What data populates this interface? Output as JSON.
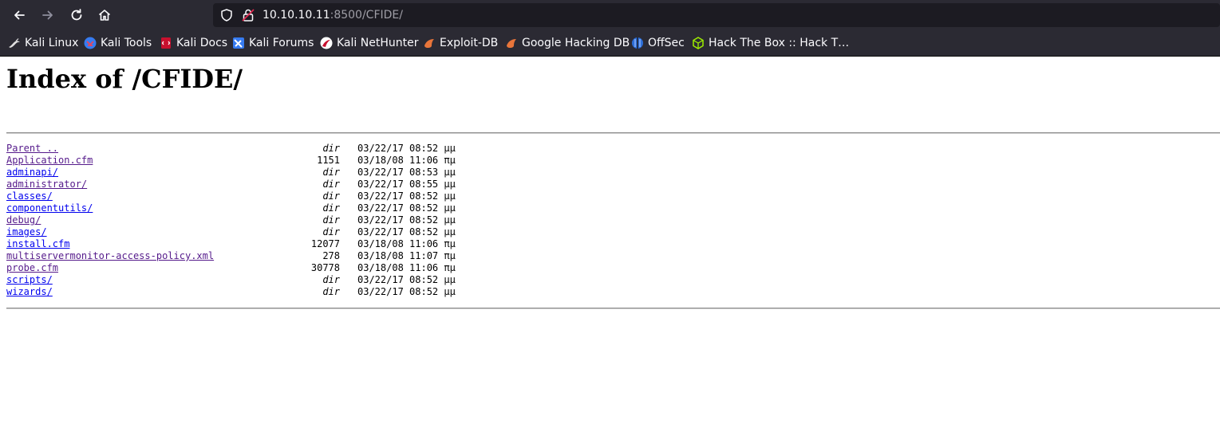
{
  "browser": {
    "url_host": "10.10.10.11",
    "url_rest": ":8500/CFIDE/",
    "bookmarks": [
      {
        "label": "Kali Linux",
        "icon": "kali-dragon-icon"
      },
      {
        "label": "Kali Tools",
        "icon": "kali-tools-icon"
      },
      {
        "label": "Kali Docs",
        "icon": "kali-docs-icon"
      },
      {
        "label": "Kali Forums",
        "icon": "kali-forums-icon"
      },
      {
        "label": "Kali NetHunter",
        "icon": "nethunter-icon"
      },
      {
        "label": "Exploit-DB",
        "icon": "exploit-db-icon"
      },
      {
        "label": "Google Hacking DB",
        "icon": "ghdb-icon"
      },
      {
        "label": "OffSec",
        "icon": "offsec-icon"
      },
      {
        "label": "Hack The Box :: Hack T…",
        "icon": "hackthebox-icon"
      }
    ]
  },
  "page": {
    "title": "Index of /CFIDE/",
    "rows": [
      {
        "name": "Parent ..",
        "size": "dir",
        "date": "03/22/17 08:52 μμ",
        "visited": true
      },
      {
        "name": "Application.cfm",
        "size": "1151",
        "date": "03/18/08 11:06 πμ",
        "visited": true
      },
      {
        "name": "adminapi/",
        "size": "dir",
        "date": "03/22/17 08:53 μμ",
        "visited": false
      },
      {
        "name": "administrator/",
        "size": "dir",
        "date": "03/22/17 08:55 μμ",
        "visited": true
      },
      {
        "name": "classes/",
        "size": "dir",
        "date": "03/22/17 08:52 μμ",
        "visited": false
      },
      {
        "name": "componentutils/",
        "size": "dir",
        "date": "03/22/17 08:52 μμ",
        "visited": false
      },
      {
        "name": "debug/",
        "size": "dir",
        "date": "03/22/17 08:52 μμ",
        "visited": true
      },
      {
        "name": "images/",
        "size": "dir",
        "date": "03/22/17 08:52 μμ",
        "visited": false
      },
      {
        "name": "install.cfm",
        "size": "12077",
        "date": "03/18/08 11:06 πμ",
        "visited": false
      },
      {
        "name": "multiservermonitor-access-policy.xml",
        "size": "278",
        "date": "03/18/08 11:07 πμ",
        "visited": true
      },
      {
        "name": "probe.cfm",
        "size": "30778",
        "date": "03/18/08 11:06 πμ",
        "visited": true
      },
      {
        "name": "scripts/",
        "size": "dir",
        "date": "03/22/17 08:52 μμ",
        "visited": false
      },
      {
        "name": "wizards/",
        "size": "dir",
        "date": "03/22/17 08:52 μμ",
        "visited": false
      }
    ]
  },
  "colors": {
    "chrome_bg": "#2b2a33",
    "urlbar_bg": "#1c1b22",
    "link": "#0000ee",
    "visited_link": "#551a8b"
  }
}
